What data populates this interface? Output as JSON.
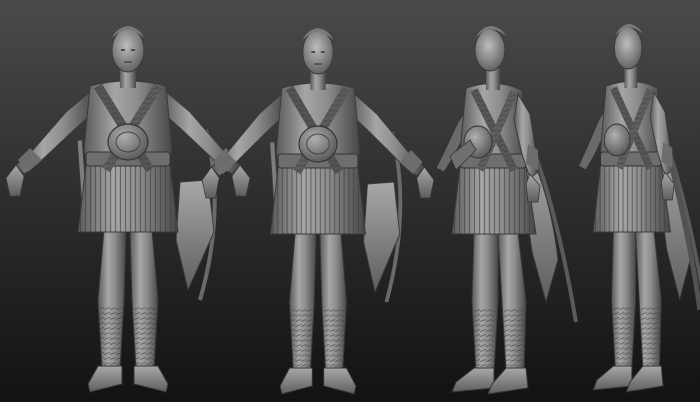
{
  "scene": {
    "subject": "clay-sculpt-turnaround",
    "views": [
      {
        "id": "front",
        "angle_deg": 0
      },
      {
        "id": "three-quarter-left",
        "angle_deg": 20
      },
      {
        "id": "three-quarter",
        "angle_deg": 45
      },
      {
        "id": "profile",
        "angle_deg": 80
      }
    ],
    "colors": {
      "background_top": "#4a4a4a",
      "background_bottom": "#111111",
      "clay_light": "#b4b4b4",
      "clay_mid": "#8a8a8a",
      "clay_dark": "#4c4c4c",
      "clay_shadow": "#2e2e2e"
    }
  }
}
